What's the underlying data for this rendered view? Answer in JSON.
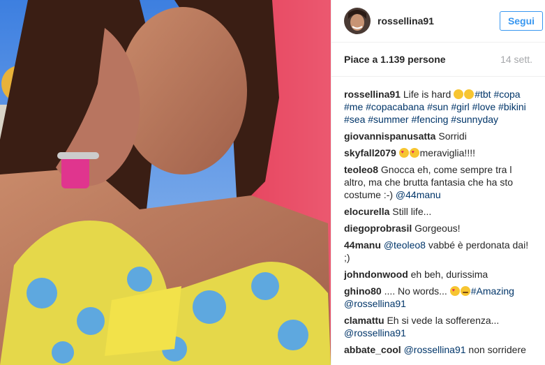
{
  "header": {
    "username": "rossellina91",
    "follow_label": "Segui"
  },
  "stats": {
    "likes": "Piace a 1.139 persone",
    "age": "14 sett."
  },
  "caption": {
    "user": "rossellina91",
    "text": "Life is hard",
    "hashtags": "#tbt #copa #me #copacabana #sun #girl #love #bikini #sea #summer #fencing #sunnyday"
  },
  "comments": [
    {
      "user": "giovannispanusatta",
      "text": "Sorridi"
    },
    {
      "user": "skyfall2079",
      "text": "meraviglia!!!!"
    },
    {
      "user": "teoleo8",
      "text": "Gnocca eh, come sempre tra l altro, ma che brutta fantasia che ha sto costume :-) ",
      "mention": "@44manu"
    },
    {
      "user": "elocurella",
      "text": "Still life..."
    },
    {
      "user": "diegoprobrasil",
      "text": "Gorgeous!"
    },
    {
      "user": "44manu",
      "mention": "@teoleo8",
      "text": " vabbé è perdonata dai! ;)"
    },
    {
      "user": "johndonwood",
      "text": "eh beh, durissima"
    },
    {
      "user": "ghino80",
      "text": ".... No words...",
      "tag": "#Amazing",
      "mention": "@rossellina91"
    },
    {
      "user": "clamattu",
      "text": "Eh si vede la sofferenza...",
      "mention": "@rossellina91"
    },
    {
      "user": "abbate_cool",
      "mention": "@rossellina91",
      "text": " non sorridere"
    }
  ],
  "colors": {
    "link": "#003569",
    "follow_blue": "#3897f0",
    "muted": "#a5a7aa"
  },
  "icons": [
    "avatar-photo",
    "laugh-emoji",
    "blush-emoji",
    "heart-eyes-emoji",
    "wink-emoji"
  ]
}
